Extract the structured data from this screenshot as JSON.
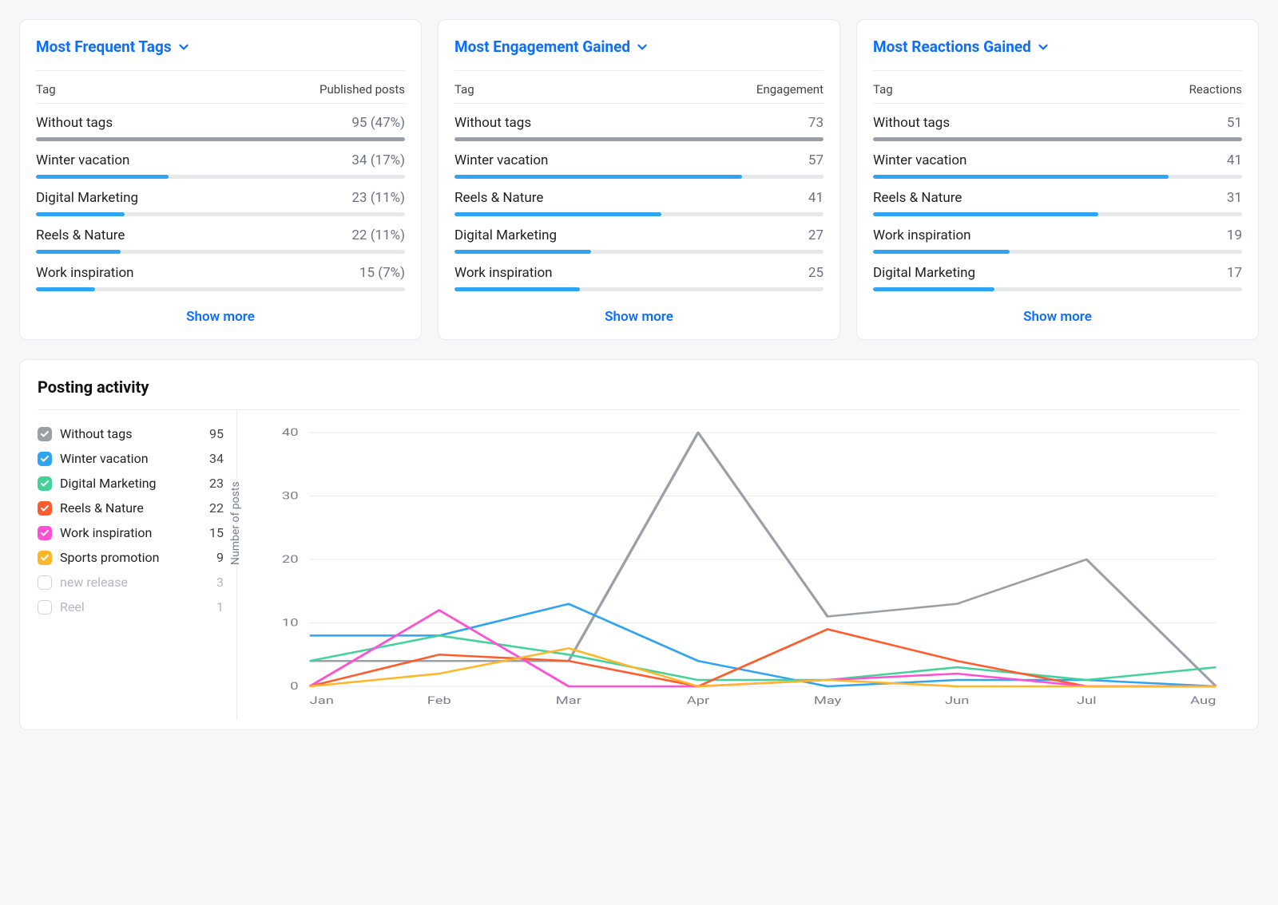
{
  "cards": [
    {
      "title": "Most Frequent Tags",
      "col_left": "Tag",
      "col_right": "Published posts",
      "show_more": "Show more",
      "rows": [
        {
          "label": "Without tags",
          "value": "95 (47%)",
          "pct": 100,
          "gray": true
        },
        {
          "label": "Winter vacation",
          "value": "34 (17%)",
          "pct": 36
        },
        {
          "label": "Digital Marketing",
          "value": "23 (11%)",
          "pct": 24
        },
        {
          "label": "Reels & Nature",
          "value": "22 (11%)",
          "pct": 23
        },
        {
          "label": "Work inspiration",
          "value": "15 (7%)",
          "pct": 16
        }
      ]
    },
    {
      "title": "Most Engagement Gained",
      "col_left": "Tag",
      "col_right": "Engagement",
      "show_more": "Show more",
      "rows": [
        {
          "label": "Without tags",
          "value": "73",
          "pct": 100,
          "gray": true
        },
        {
          "label": "Winter vacation",
          "value": "57",
          "pct": 78
        },
        {
          "label": "Reels & Nature",
          "value": "41",
          "pct": 56
        },
        {
          "label": "Digital Marketing",
          "value": "27",
          "pct": 37
        },
        {
          "label": "Work inspiration",
          "value": "25",
          "pct": 34
        }
      ]
    },
    {
      "title": "Most Reactions Gained",
      "col_left": "Tag",
      "col_right": "Reactions",
      "show_more": "Show more",
      "rows": [
        {
          "label": "Without tags",
          "value": "51",
          "pct": 100,
          "gray": true
        },
        {
          "label": "Winter vacation",
          "value": "41",
          "pct": 80
        },
        {
          "label": "Reels & Nature",
          "value": "31",
          "pct": 61
        },
        {
          "label": "Work inspiration",
          "value": "19",
          "pct": 37
        },
        {
          "label": "Digital Marketing",
          "value": "17",
          "pct": 33
        }
      ]
    }
  ],
  "posting": {
    "title": "Posting activity",
    "legend": [
      {
        "label": "Without tags",
        "value": 95,
        "color": "#9aa0a6",
        "checked": true
      },
      {
        "label": "Winter vacation",
        "value": 34,
        "color": "#2fa4f3",
        "checked": true
      },
      {
        "label": "Digital Marketing",
        "value": 23,
        "color": "#45d29a",
        "checked": true
      },
      {
        "label": "Reels & Nature",
        "value": 22,
        "color": "#ff5c2e",
        "checked": true
      },
      {
        "label": "Work inspiration",
        "value": 15,
        "color": "#ff4fd3",
        "checked": true
      },
      {
        "label": "Sports promotion",
        "value": 9,
        "color": "#ffb628",
        "checked": true
      },
      {
        "label": "new release",
        "value": 3,
        "color": "",
        "checked": false
      },
      {
        "label": "Reel",
        "value": 1,
        "color": "",
        "checked": false
      }
    ]
  },
  "chart_data": {
    "type": "line",
    "title": "Posting activity",
    "xlabel": "",
    "ylabel": "Number of posts",
    "x": [
      "Jan",
      "Feb",
      "Mar",
      "Apr",
      "May",
      "Jun",
      "Jul",
      "Aug"
    ],
    "yticks": [
      0,
      10,
      20,
      30,
      40
    ],
    "ylim": [
      0,
      40
    ],
    "series": [
      {
        "name": "Without tags",
        "color": "#9aa0a6",
        "values": [
          4,
          4,
          4,
          40,
          11,
          13,
          20,
          0
        ]
      },
      {
        "name": "Winter vacation",
        "color": "#2fa4f3",
        "values": [
          8,
          8,
          13,
          4,
          0,
          1,
          1,
          0
        ]
      },
      {
        "name": "Digital Marketing",
        "color": "#45d29a",
        "values": [
          4,
          8,
          5,
          1,
          1,
          3,
          1,
          3
        ]
      },
      {
        "name": "Reels & Nature",
        "color": "#ff5c2e",
        "values": [
          0,
          5,
          4,
          0,
          9,
          4,
          0,
          0
        ]
      },
      {
        "name": "Work inspiration",
        "color": "#ff4fd3",
        "values": [
          0,
          12,
          0,
          0,
          1,
          2,
          0,
          0
        ]
      },
      {
        "name": "Sports promotion",
        "color": "#ffb628",
        "values": [
          0,
          2,
          6,
          0,
          1,
          0,
          0,
          0
        ]
      }
    ]
  },
  "colors": {
    "link": "#0d6efd"
  }
}
